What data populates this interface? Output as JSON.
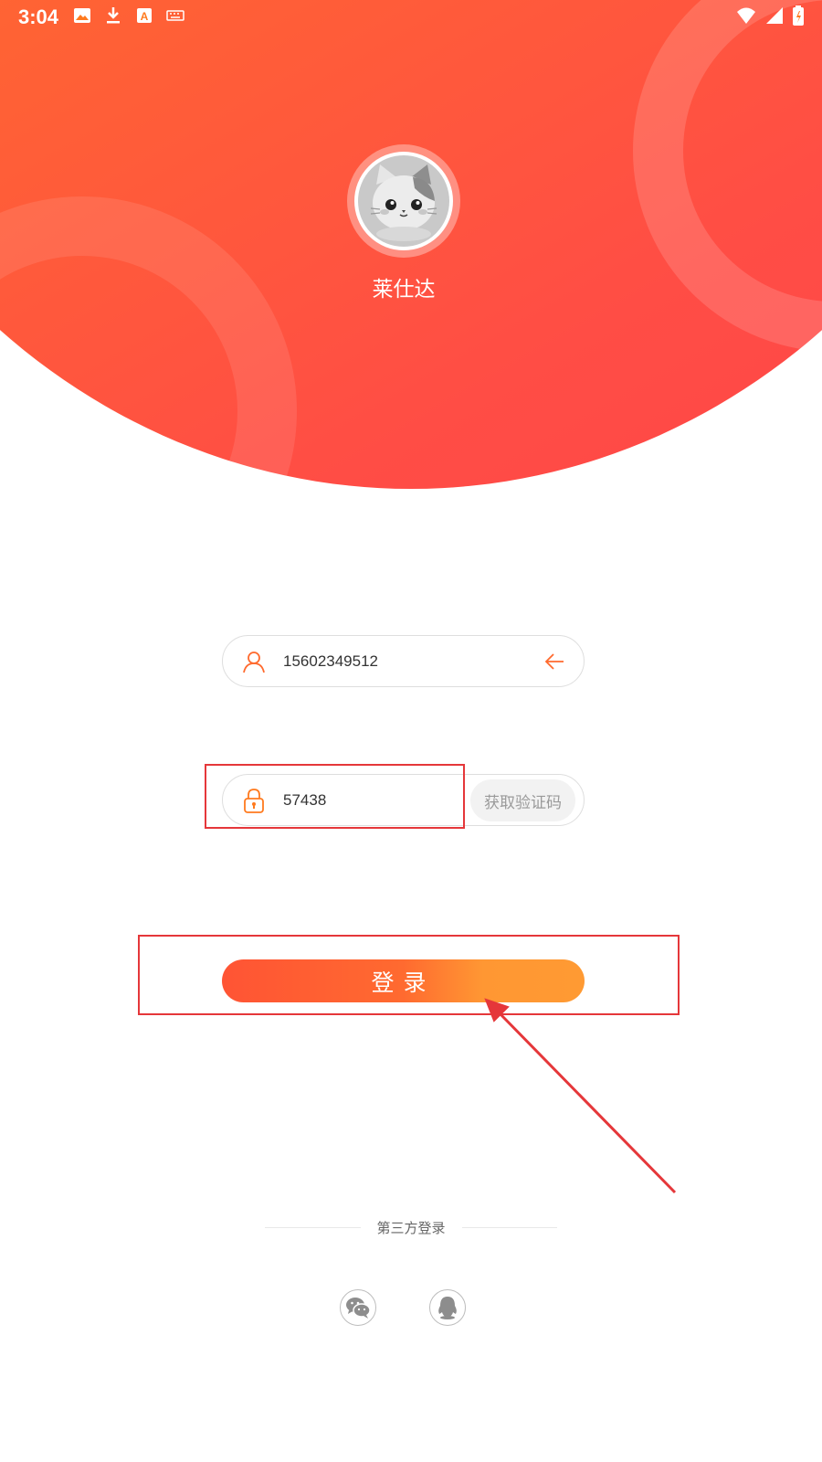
{
  "status_bar": {
    "time": "3:04"
  },
  "app": {
    "name": "莱仕达"
  },
  "phone_field": {
    "value": "15602349512"
  },
  "code_field": {
    "value": "57438",
    "get_code_label": "获取验证码"
  },
  "login_button": {
    "label": "登录"
  },
  "third_party": {
    "title": "第三方登录"
  },
  "colors": {
    "brand_orange": "#ff7a1e",
    "brand_red": "#ff4549",
    "annotation_red": "#e5373a"
  }
}
